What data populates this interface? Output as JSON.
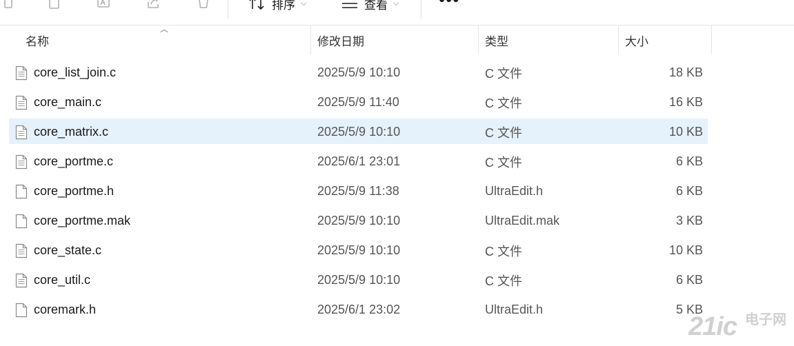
{
  "toolbar": {
    "icons": [
      "copy-icon",
      "paste-icon",
      "rename-icon",
      "share-icon",
      "delete-icon"
    ],
    "sort_label": "排序",
    "view_label": "查看",
    "more_label": "•••"
  },
  "columns": {
    "name": "名称",
    "date": "修改日期",
    "type": "类型",
    "size": "大小"
  },
  "files": [
    {
      "name": "core_list_join.c",
      "date": "2025/5/9 10:10",
      "type": "C 文件",
      "size": "18 KB",
      "icon": "text-file-icon"
    },
    {
      "name": "core_main.c",
      "date": "2025/5/9 11:40",
      "type": "C 文件",
      "size": "16 KB",
      "icon": "text-file-icon"
    },
    {
      "name": "core_matrix.c",
      "date": "2025/5/9 10:10",
      "type": "C 文件",
      "size": "10 KB",
      "icon": "text-file-icon"
    },
    {
      "name": "core_portme.c",
      "date": "2025/6/1 23:01",
      "type": "C 文件",
      "size": "6 KB",
      "icon": "text-file-icon"
    },
    {
      "name": "core_portme.h",
      "date": "2025/5/9 11:38",
      "type": "UltraEdit.h",
      "size": "6 KB",
      "icon": "blank-file-icon"
    },
    {
      "name": "core_portme.mak",
      "date": "2025/5/9 10:10",
      "type": "UltraEdit.mak",
      "size": "3 KB",
      "icon": "blank-file-icon"
    },
    {
      "name": "core_state.c",
      "date": "2025/5/9 10:10",
      "type": "C 文件",
      "size": "10 KB",
      "icon": "text-file-icon"
    },
    {
      "name": "core_util.c",
      "date": "2025/5/9 10:10",
      "type": "C 文件",
      "size": "6 KB",
      "icon": "text-file-icon"
    },
    {
      "name": "coremark.h",
      "date": "2025/6/1 23:02",
      "type": "UltraEdit.h",
      "size": "5 KB",
      "icon": "blank-file-icon"
    }
  ],
  "selected_file": "core_matrix.c",
  "watermark": {
    "brand": "21ic",
    "cn": "电子网"
  },
  "colors": {
    "selection": "#e5f1fb",
    "secondary_text": "#555555",
    "watermark": "#d0d0d0"
  }
}
